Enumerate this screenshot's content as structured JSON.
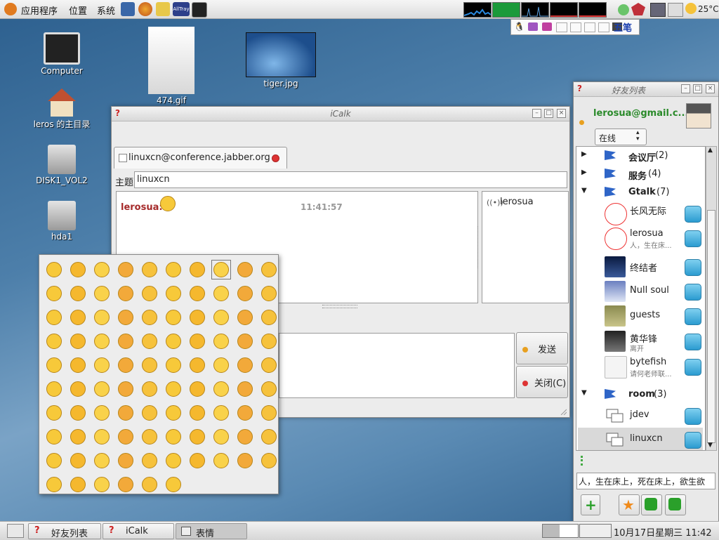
{
  "top_panel": {
    "menus": [
      "应用程序",
      "位置",
      "系统"
    ],
    "input_method": "五笔",
    "weather": "25°C"
  },
  "desktop": {
    "icons": [
      "Computer",
      "leros 的主目录",
      "DISK1_VOL2",
      "hda1",
      "474.gif",
      "tiger.jpg"
    ]
  },
  "chat_window": {
    "title": "iCalk",
    "tab_label": "linuxcn@conference.jabber.org",
    "subject_label": "主题",
    "subject_value": "linuxcn",
    "message_sender": "lerosua:",
    "message_time": "11:41:57",
    "participant": "lerosua",
    "send_label": "发送",
    "close_label": "关闭(C)"
  },
  "buddy_window": {
    "title": "好友列表",
    "account": "lerosua@gmail.c...",
    "status": "在线",
    "groups": [
      {
        "name": "会议厅",
        "count": "(2)"
      },
      {
        "name": "服务",
        "count": "(4)"
      },
      {
        "name": "Gtalk",
        "count": "(7)"
      },
      {
        "name": "room",
        "count": "(3)"
      }
    ],
    "buddies": [
      {
        "name": "长风无际",
        "status": ""
      },
      {
        "name": "lerosua",
        "status": "人，生在床..."
      },
      {
        "name": "终结者",
        "status": ""
      },
      {
        "name": "Null soul",
        "status": ""
      },
      {
        "name": "guests",
        "status": ""
      },
      {
        "name": "黄华锋",
        "status": "离开"
      },
      {
        "name": "bytefish",
        "status": "请何老师联..."
      }
    ],
    "rooms": [
      "jdev",
      "linuxcn"
    ],
    "signature": "人，生在床上，死在床上，欲生欲"
  },
  "taskbar": {
    "items": [
      "好友列表",
      "iCalk",
      "表情"
    ],
    "clock": "10月17日星期三 11:42"
  }
}
